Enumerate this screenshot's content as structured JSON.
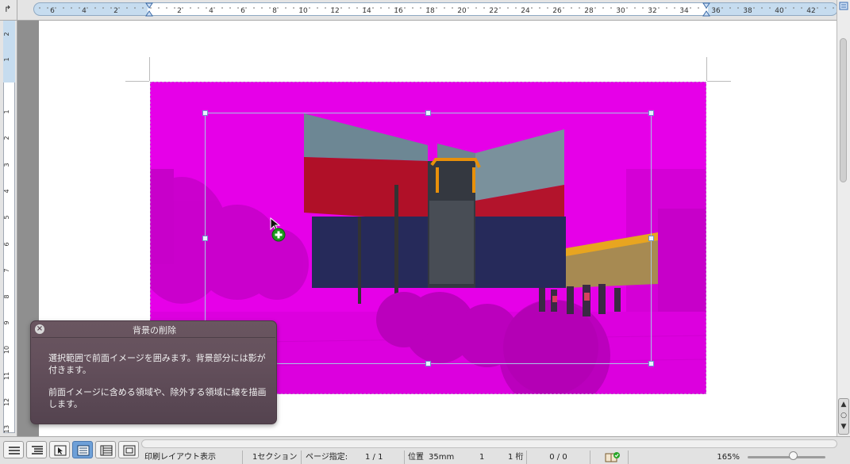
{
  "ruler": {
    "corner_symbol": "↱",
    "h_ticks": [
      "6",
      "4",
      "2",
      "2",
      "4",
      "6",
      "8",
      "10",
      "12",
      "14",
      "16",
      "18",
      "20",
      "22",
      "24",
      "26",
      "28",
      "30",
      "32",
      "34",
      "36",
      "38",
      "40",
      "42"
    ],
    "v_ticks": [
      "2",
      "1",
      "1",
      "2",
      "3",
      "4",
      "5",
      "6",
      "7",
      "8",
      "9",
      "10",
      "11",
      "12",
      "13"
    ]
  },
  "panel": {
    "title": "背景の削除",
    "close_symbol": "×",
    "text1": "選択範囲で前面イメージを囲みます。背景部分には影が付きます。",
    "text2": "前面イメージに含める領域や、除外する領域に線を描画します。"
  },
  "status": {
    "view_mode": "印刷レイアウト表示",
    "section": "1セクション",
    "page_label": "ページ指定:",
    "page_value": "1 / 1",
    "position_label": "位置",
    "position_value": "35mm",
    "line_value": "1",
    "column_value": "1 桁",
    "count_value": "0 / 0",
    "zoom": "165%"
  },
  "colors": {
    "background_mark": "#e600e8",
    "accent": "#6ea0d8"
  },
  "icons": {
    "view_buttons": [
      "draft-view-icon",
      "outline-view-icon",
      "publishing-layout-icon",
      "print-layout-icon",
      "notebook-layout-icon",
      "full-screen-icon"
    ]
  }
}
